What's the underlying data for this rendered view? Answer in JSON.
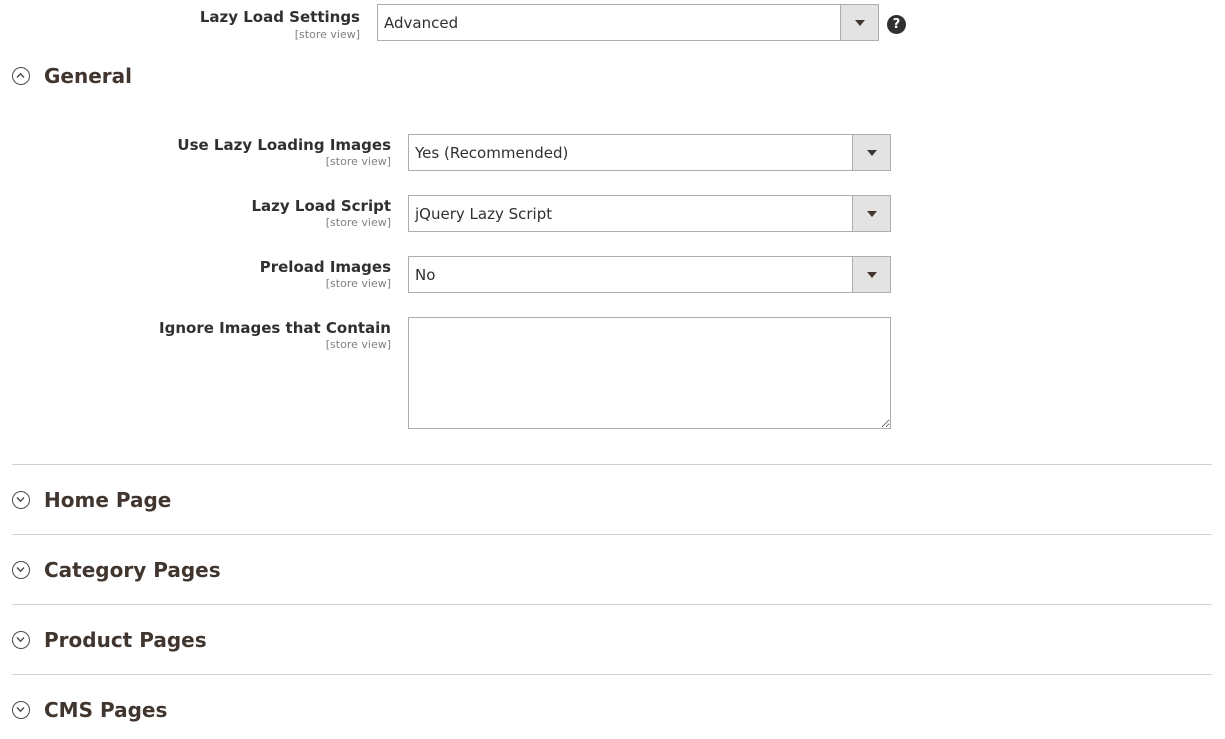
{
  "top_setting": {
    "label": "Lazy Load Settings",
    "scope": "[store view]",
    "value": "Advanced",
    "help": "?"
  },
  "general": {
    "title": "General",
    "fields": [
      {
        "label": "Use Lazy Loading Images",
        "scope": "[store view]",
        "value": "Yes (Recommended)"
      },
      {
        "label": "Lazy Load Script",
        "scope": "[store view]",
        "value": "jQuery Lazy Script"
      },
      {
        "label": "Preload Images",
        "scope": "[store view]",
        "value": "No"
      },
      {
        "label": "Ignore Images that Contain",
        "scope": "[store view]",
        "value": ""
      }
    ]
  },
  "sections": [
    {
      "title": "Home Page"
    },
    {
      "title": "Category Pages"
    },
    {
      "title": "Product Pages"
    },
    {
      "title": "CMS Pages"
    }
  ],
  "colors": {
    "label_text": "#303030",
    "scope_text": "#808080",
    "border": "#adadad",
    "arrow_bg": "#e3e3e3",
    "section_title": "#41362f",
    "divider": "#d1d1d1"
  }
}
